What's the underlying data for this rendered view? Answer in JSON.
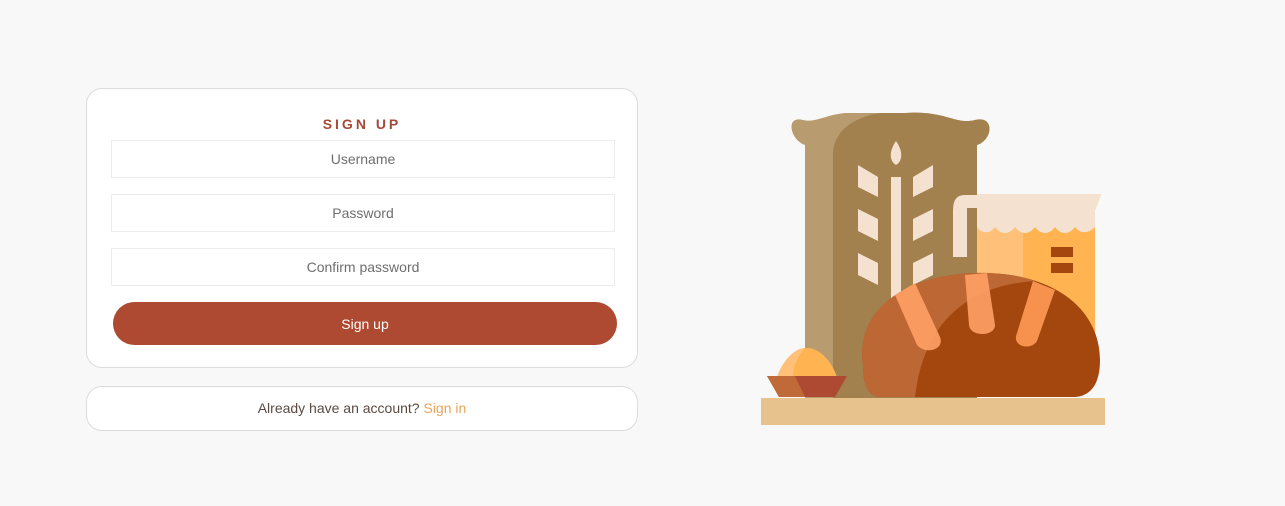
{
  "signup": {
    "title": "SIGN UP",
    "username_placeholder": "Username",
    "password_placeholder": "Password",
    "confirm_placeholder": "Confirm password",
    "submit_label": "Sign up"
  },
  "signin": {
    "prompt": "Already have an account?",
    "link_label": "Sign in"
  },
  "colors": {
    "accent": "#ae4a32",
    "link": "#e8a55c",
    "background": "#f8f8f8"
  },
  "illustration": {
    "icon": "bakery-flour-bread-icon"
  }
}
